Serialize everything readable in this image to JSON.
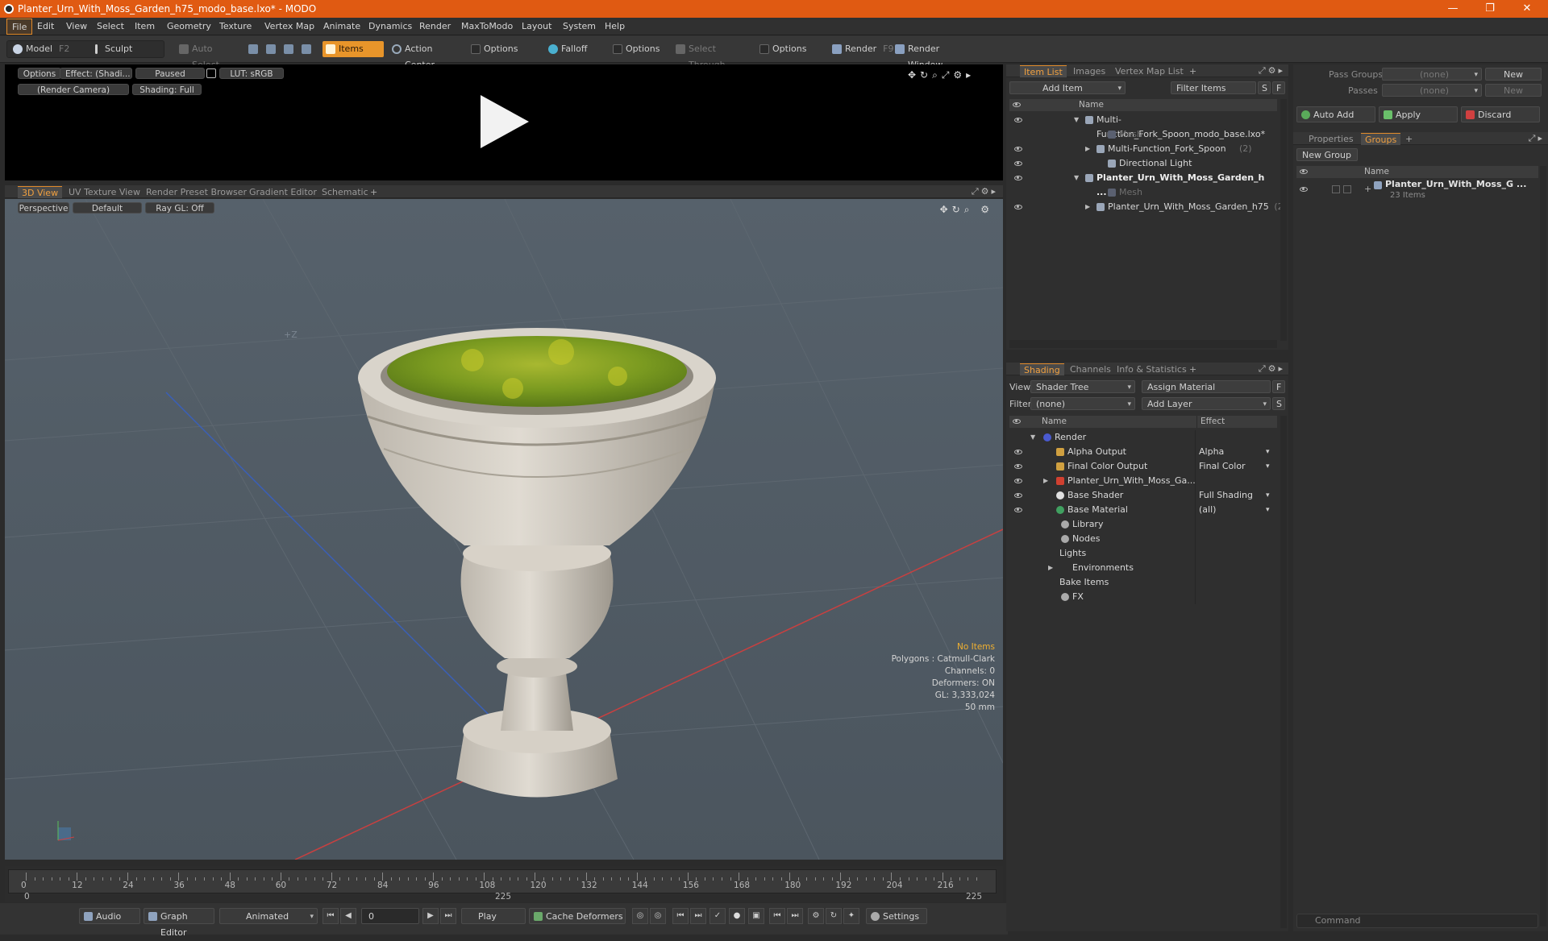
{
  "window": {
    "title": "Planter_Urn_With_Moss_Garden_h75_modo_base.lxo* - MODO",
    "controls": [
      "—",
      "❐",
      "✕"
    ]
  },
  "menu": [
    "File",
    "Edit",
    "View",
    "Select",
    "Item",
    "Geometry",
    "Texture",
    "Vertex Map",
    "Animate",
    "Dynamics",
    "Render",
    "MaxToModo",
    "Layout",
    "System",
    "Help"
  ],
  "toolbar": {
    "model": "Model",
    "model_key": "F2",
    "sculpt": "Sculpt",
    "auto_select": "Auto Select",
    "items": "Items",
    "action_center": "Action Center",
    "options1": "Options",
    "falloff": "Falloff",
    "options2": "Options",
    "select_through": "Select Through",
    "options3": "Options",
    "render": "Render",
    "render_key": "F9",
    "render_window": "Render Window"
  },
  "preview": {
    "options": "Options",
    "effect": "Effect: (Shadi...",
    "paused": "Paused",
    "lut": "LUT: sRGB",
    "camera": "(Render Camera)",
    "shading": "Shading: Full"
  },
  "viewport_tabs": [
    "3D View",
    "UV Texture View",
    "Render Preset Browser",
    "Gradient Editor",
    "Schematic",
    "+"
  ],
  "viewport": {
    "perspective": "Perspective",
    "default": "Default",
    "raygl": "Ray GL: Off",
    "axis_label": "+Z",
    "overlay": {
      "no_items": "No Items",
      "polygons": "Polygons : Catmull-Clark",
      "channels": "Channels: 0",
      "deformers": "Deformers: ON",
      "gl": "GL: 3,333,024",
      "focal": "50 mm"
    }
  },
  "timeline": {
    "ticks": [
      "0",
      "12",
      "24",
      "36",
      "48",
      "60",
      "72",
      "84",
      "96",
      "108",
      "120",
      "132",
      "144",
      "156",
      "168",
      "180",
      "192",
      "204",
      "216"
    ],
    "start": "0",
    "mid": "225",
    "end": "225"
  },
  "bottombar": {
    "audio": "Audio",
    "graph_editor": "Graph Editor",
    "animated": "Animated",
    "frame": "0",
    "play": "Play",
    "cache_deformers": "Cache Deformers",
    "settings": "Settings"
  },
  "item_list": {
    "tabs": [
      "Item List",
      "Images",
      "Vertex Map List",
      "+"
    ],
    "add_item": "Add Item",
    "filter_items": "Filter Items",
    "s": "S",
    "f": "F",
    "col_name": "Name",
    "rows": [
      {
        "label": "Multi-Function_Fork_Spoon_modo_base.lxo*",
        "count": "",
        "indent": 0,
        "bold": false,
        "dim": false
      },
      {
        "label": "Mesh",
        "count": "",
        "indent": 2,
        "bold": false,
        "dim": true
      },
      {
        "label": "Multi-Function_Fork_Spoon",
        "count": "(2)",
        "indent": 1,
        "bold": false,
        "dim": false
      },
      {
        "label": "Directional Light",
        "count": "",
        "indent": 2,
        "bold": false,
        "dim": false
      },
      {
        "label": "Planter_Urn_With_Moss_Garden_h ...",
        "count": "",
        "indent": 0,
        "bold": true,
        "dim": false
      },
      {
        "label": "Mesh",
        "count": "",
        "indent": 2,
        "bold": false,
        "dim": true
      },
      {
        "label": "Planter_Urn_With_Moss_Garden_h75",
        "count": "(2)",
        "indent": 1,
        "bold": false,
        "dim": false
      }
    ]
  },
  "shading": {
    "tabs": [
      "Shading",
      "Channels",
      "Info & Statistics",
      "+"
    ],
    "view_label": "View",
    "view_value": "Shader Tree",
    "assign_material": "Assign Material",
    "filter_label": "Filter",
    "filter_value": "(none)",
    "add_layer": "Add Layer",
    "f": "F",
    "s": "S",
    "col_name": "Name",
    "col_effect": "Effect",
    "rows": [
      {
        "label": "Render",
        "effect": "",
        "indent": 0
      },
      {
        "label": "Alpha Output",
        "effect": "Alpha",
        "indent": 1
      },
      {
        "label": "Final Color Output",
        "effect": "Final Color",
        "indent": 1
      },
      {
        "label": "Planter_Urn_With_Moss_Ga...",
        "effect": "",
        "indent": 1
      },
      {
        "label": "Base Shader",
        "effect": "Full Shading",
        "indent": 1
      },
      {
        "label": "Base Material",
        "effect": "(all)",
        "indent": 1
      },
      {
        "label": "Library",
        "effect": "",
        "indent": 0
      },
      {
        "label": "Nodes",
        "effect": "",
        "indent": 0
      },
      {
        "label": "Lights",
        "effect": "",
        "indent": 0
      },
      {
        "label": "Environments",
        "effect": "",
        "indent": 0
      },
      {
        "label": "Bake Items",
        "effect": "",
        "indent": 0
      },
      {
        "label": "FX",
        "effect": "",
        "indent": 0
      }
    ]
  },
  "groups": {
    "pass_groups_label": "Pass Groups",
    "pass_groups_value": "(none)",
    "passes_label": "Passes",
    "passes_value": "(none)",
    "new": "New",
    "new2": "New",
    "auto_add": "Auto Add",
    "apply": "Apply",
    "discard": "Discard",
    "tabs": [
      "Properties",
      "Groups",
      "+"
    ],
    "new_group": "New Group",
    "col_name": "Name",
    "group_name": "Planter_Urn_With_Moss_G ...",
    "group_count": "23 Items"
  },
  "command": {
    "placeholder": "Command"
  },
  "colors": {
    "accent": "#e08a2a",
    "title": "#e05a12",
    "moss": "#8aa828",
    "urn": "#d2ccc2"
  }
}
